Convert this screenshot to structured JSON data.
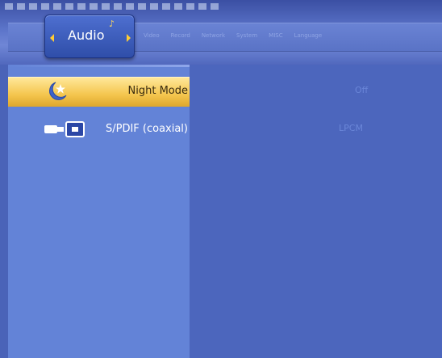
{
  "header": {
    "active_tab": "Audio",
    "tabs": [
      "Video",
      "Record",
      "Network",
      "System",
      "MISC",
      "Language"
    ]
  },
  "settings": [
    {
      "label": "Night Mode",
      "value": "Off",
      "icon": "moon-star-icon",
      "selected": true
    },
    {
      "label": "S/PDIF (coaxial)",
      "value": "LPCM",
      "icon": "spdif-connector-icon",
      "selected": false
    }
  ],
  "colors": {
    "highlight": "#f4c54d",
    "left_panel": "#6383d7",
    "right_panel": "#4c66bd",
    "active_tab": "#2f4ea9"
  }
}
